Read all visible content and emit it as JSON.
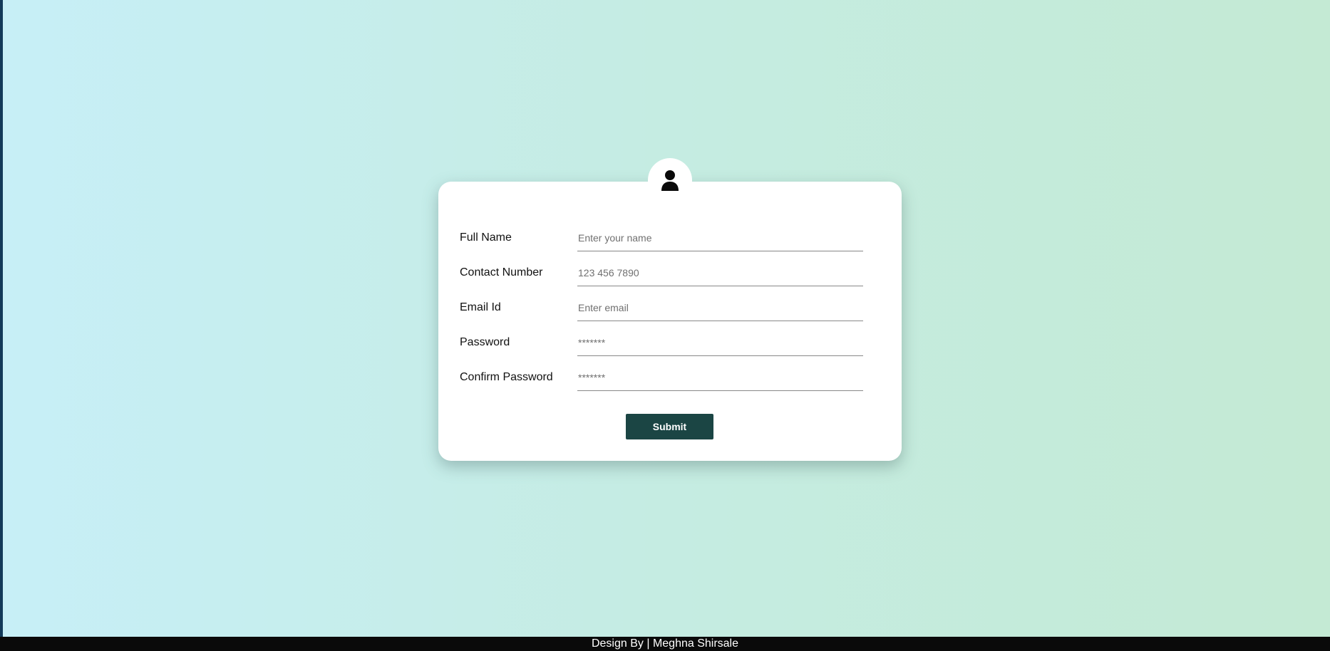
{
  "form": {
    "avatar_icon": "user-icon",
    "fields": [
      {
        "label": "Full Name",
        "placeholder": "Enter your name",
        "type": "text"
      },
      {
        "label": "Contact Number",
        "placeholder": "123 456 7890",
        "type": "tel"
      },
      {
        "label": "Email Id",
        "placeholder": "Enter email",
        "type": "email"
      },
      {
        "label": "Password",
        "placeholder": "*******",
        "type": "password"
      },
      {
        "label": "Confirm Password",
        "placeholder": "*******",
        "type": "password"
      }
    ],
    "submit_label": "Submit"
  },
  "footer": {
    "text": "Design By | Meghna Shirsale"
  },
  "colors": {
    "button_bg": "#1b4544",
    "footer_bg": "#0a0a0a",
    "card_bg": "#ffffff"
  }
}
